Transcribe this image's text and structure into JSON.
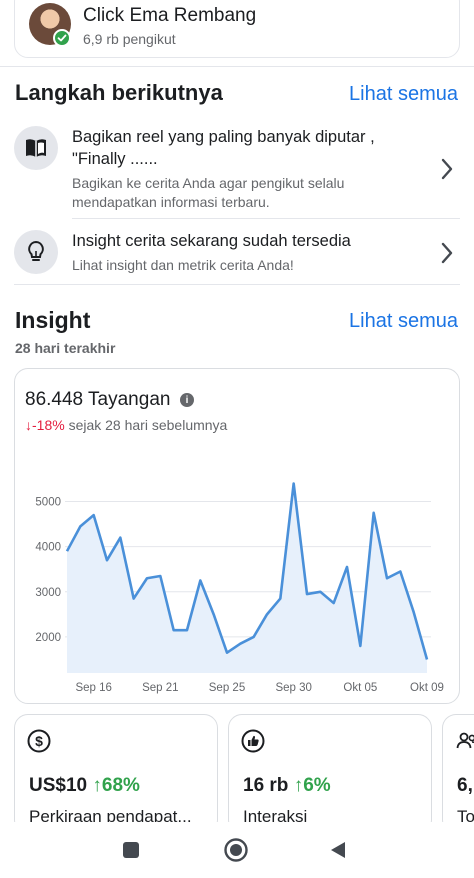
{
  "profile": {
    "name": "Click Ema Rembang",
    "followers": "6,9 rb pengikut"
  },
  "next_steps": {
    "title": "Langkah berikutnya",
    "see_all": "Lihat semua",
    "items": [
      {
        "title": "Bagikan reel yang paling banyak diputar , \"Finally ......",
        "description": "Bagikan ke cerita Anda agar pengikut selalu mendapatkan informasi terbaru.",
        "icon": "book-icon"
      },
      {
        "title": "Insight cerita sekarang sudah tersedia",
        "description": "Lihat insight dan metrik cerita Anda!",
        "icon": "lightbulb-icon"
      }
    ]
  },
  "insight": {
    "title": "Insight",
    "see_all": "Lihat semua",
    "period": "28 hari terakhir",
    "views_label": "86.448 Tayangan",
    "change_value": "↓-18%",
    "change_text": " sejak 28 hari sebelumnya"
  },
  "chart_data": {
    "type": "area",
    "title": "86.448 Tayangan",
    "xlabel": "",
    "ylabel": "",
    "ylim": [
      1200,
      5500
    ],
    "yticks": [
      2000,
      3000,
      4000,
      5000
    ],
    "xtick_labels": [
      "Sep 16",
      "Sep 21",
      "Sep 25",
      "Sep 30",
      "Okt 05",
      "Okt 09"
    ],
    "xtick_index": [
      2,
      7,
      12,
      17,
      22,
      27
    ],
    "grid": true,
    "color": "#4a90d9",
    "fill": "#e7f0fb",
    "series": [
      {
        "values": [
          3900,
          4450,
          4700,
          3700,
          4200,
          2850,
          3300,
          3350,
          2150,
          2150,
          3250,
          2500,
          1650,
          1850,
          2000,
          2500,
          2850,
          5400,
          2950,
          3000,
          2750,
          3550,
          1800,
          4750,
          3300,
          3450,
          2550,
          1500
        ]
      }
    ]
  },
  "metrics": [
    {
      "icon": "dollar-icon",
      "value": "US$10",
      "change": "↑68%",
      "label": "Perkiraan pendapat..."
    },
    {
      "icon": "thumbs-up-icon",
      "value": "16 rb",
      "change": "↑6%",
      "label": "Interaksi"
    },
    {
      "icon": "people-icon",
      "value": "6,",
      "change": "",
      "label": "To"
    }
  ],
  "colors": {
    "accent": "#1b74e4",
    "positive": "#31a24c",
    "negative": "#e41e3f"
  }
}
